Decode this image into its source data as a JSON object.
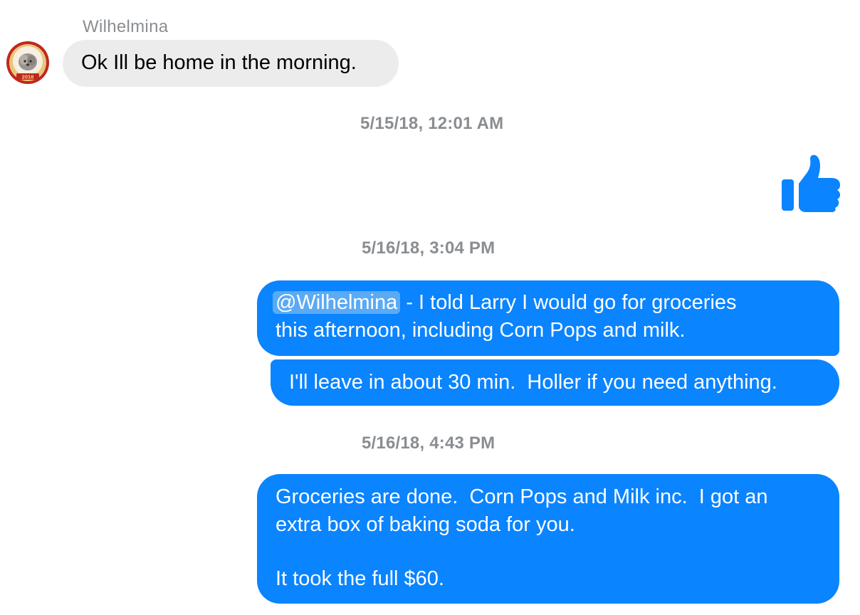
{
  "thread": {
    "incoming": {
      "sender_name": "Wilhelmina",
      "avatar_badge_text": "2018",
      "message": "Ok Ill be home in the morning."
    },
    "timestamps": [
      "5/15/18, 12:01 AM",
      "5/16/18, 3:04 PM",
      "5/16/18, 4:43 PM"
    ],
    "like_icon": "thumbs-up-icon",
    "outgoing": [
      {
        "mention": "@Wilhelmina",
        "line1_rest": " - I told Larry I would go for groceries",
        "line2": "this afternoon, including Corn Pops and milk."
      },
      {
        "text": "I'll leave in about 30 min.  Holler if you need anything."
      },
      {
        "line1": "Groceries are done.  Corn Pops and Milk inc.  I got an",
        "line2": "extra box of baking soda for you.",
        "line3": "It took the full $60."
      }
    ]
  },
  "colors": {
    "outgoing_bubble": "#0a84ff",
    "incoming_bubble": "#ececec",
    "mention_highlight": "#5aaaf5",
    "secondary_text": "#8a8d91"
  }
}
